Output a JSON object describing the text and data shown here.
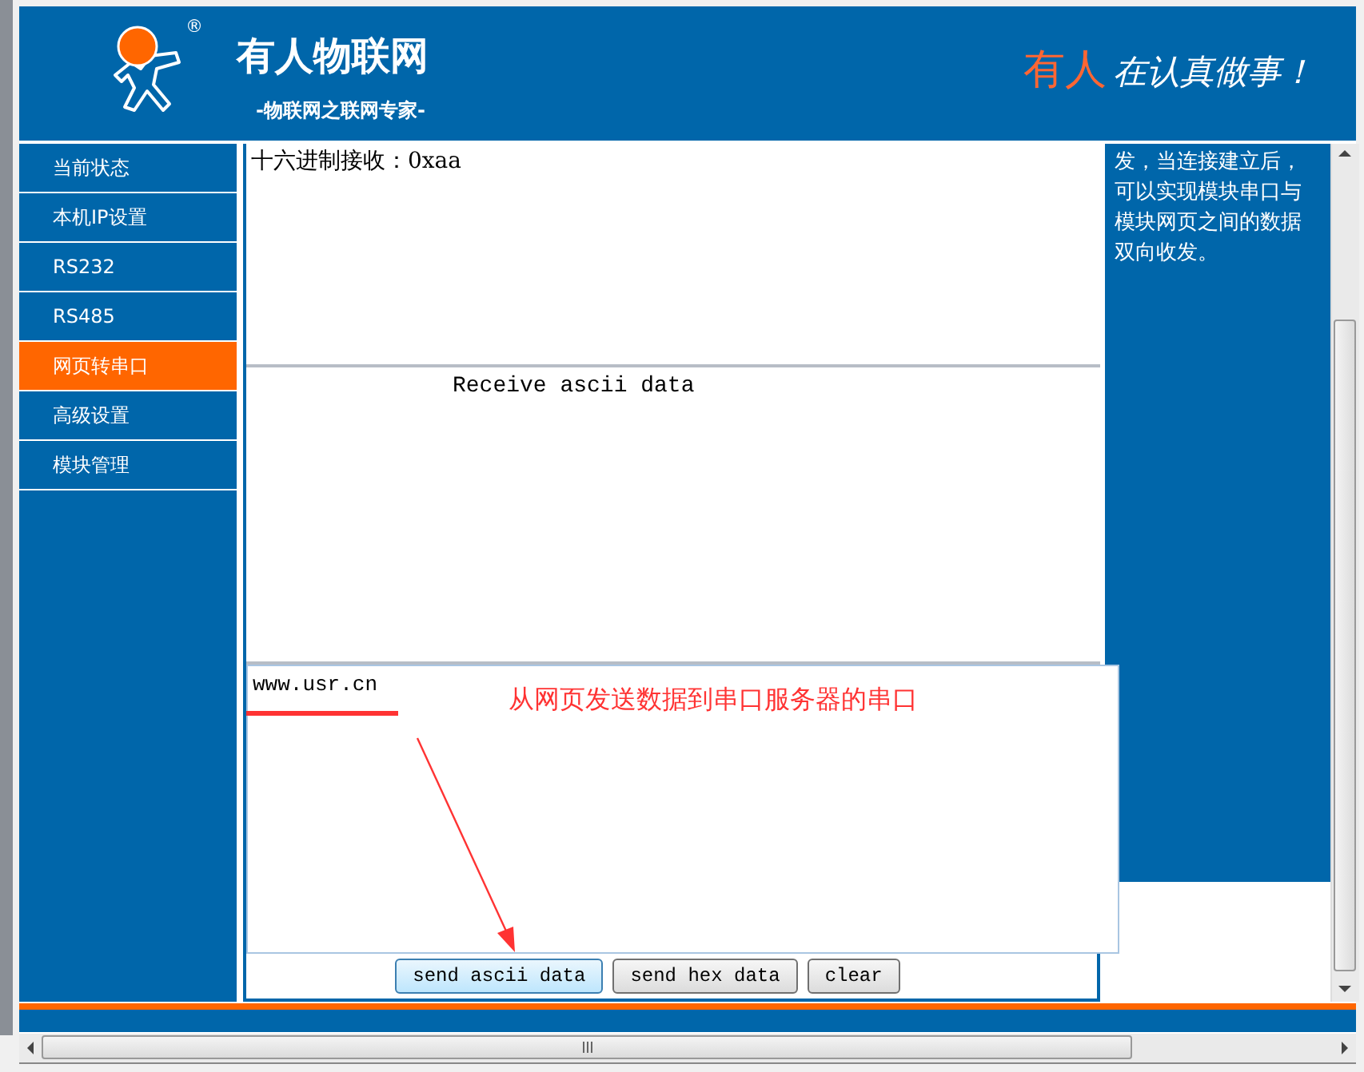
{
  "header": {
    "logo_mark": "®",
    "title": "有人物联网",
    "subtitle": "-物联网之联网专家-",
    "slogan_highlight": "有人",
    "slogan_rest": "在认真做事！"
  },
  "sidebar": {
    "items": [
      {
        "label": "当前状态",
        "selected": false
      },
      {
        "label": "本机IP设置",
        "selected": false
      },
      {
        "label": "RS232",
        "selected": false
      },
      {
        "label": "RS485",
        "selected": false
      },
      {
        "label": "网页转串口",
        "selected": true
      },
      {
        "label": "高级设置",
        "selected": false
      },
      {
        "label": "模块管理",
        "selected": false
      }
    ]
  },
  "receive_hex": {
    "value": "十六进制接收：0xaa"
  },
  "receive_ascii": {
    "value": "Receive ascii data"
  },
  "send": {
    "value": "www.usr.cn"
  },
  "annotation": "从网页发送数据到串口服务器的串口",
  "buttons": [
    {
      "label": "send ascii data",
      "focused": true
    },
    {
      "label": "send hex data",
      "focused": false
    },
    {
      "label": "clear",
      "focused": false
    }
  ],
  "info_panel": {
    "text": "发，当连接建立后，可以实现模块串口与模块网页之间的数据双向收发。"
  }
}
